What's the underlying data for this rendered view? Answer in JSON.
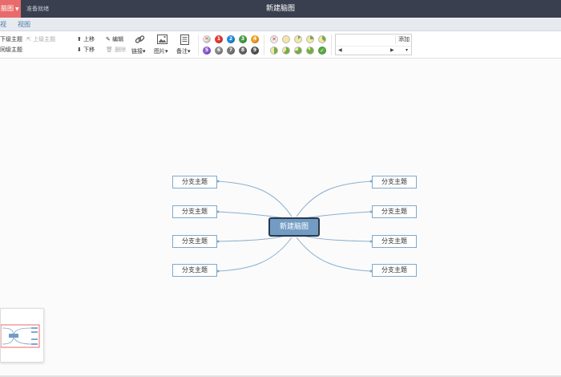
{
  "titlebar": {
    "menu_label": "脑图",
    "status": "准备就绪",
    "title": "新建脑图"
  },
  "tabs": [
    {
      "label": "视"
    },
    {
      "label": "视图"
    }
  ],
  "toolbar": {
    "insert_child": "下级主题",
    "insert_parent": "上级主题",
    "insert_sibling": "同级主题",
    "move_up": "上移",
    "move_down": "下移",
    "edit": "编辑",
    "delete": "删除",
    "link": "链接",
    "image": "图片",
    "note": "备注"
  },
  "priorities": [
    {
      "label": "✕",
      "color": "#e8e8e8"
    },
    {
      "label": "1",
      "color": "#e53935"
    },
    {
      "label": "2",
      "color": "#1e88e5"
    },
    {
      "label": "3",
      "color": "#43a047"
    },
    {
      "label": "4",
      "color": "#f59f23"
    },
    {
      "label": "5",
      "color": "#8e5ad6"
    },
    {
      "label": "6",
      "color": "#888888"
    },
    {
      "label": "7",
      "color": "#777777"
    },
    {
      "label": "8",
      "color": "#666666"
    },
    {
      "label": "9",
      "color": "#555555"
    }
  ],
  "progress": [
    {
      "fraction": 0
    },
    {
      "fraction": 0
    },
    {
      "fraction": 0.125
    },
    {
      "fraction": 0.25
    },
    {
      "fraction": 0.375
    },
    {
      "fraction": 0.5
    },
    {
      "fraction": 0.625
    },
    {
      "fraction": 0.75
    },
    {
      "fraction": 0.875
    },
    {
      "fraction": 1
    }
  ],
  "resource": {
    "add_label": "添加",
    "input_value": "",
    "prev_icon": "triangle-left-icon",
    "next_icon": "triangle-right-icon",
    "dropdown_icon": "chevron-down-icon"
  },
  "mindmap": {
    "root": "新建脑图",
    "left_branches": [
      "分支主题",
      "分支主题",
      "分支主题",
      "分支主题"
    ],
    "right_branches": [
      "分支主题",
      "分支主题",
      "分支主题",
      "分支主题"
    ]
  },
  "colors": {
    "title_bg": "#393f4f",
    "menu_accent": "#e96a6a",
    "root_fill": "#729cc4",
    "branch_border": "#7fa9cc",
    "edge": "#8ab0d0"
  }
}
